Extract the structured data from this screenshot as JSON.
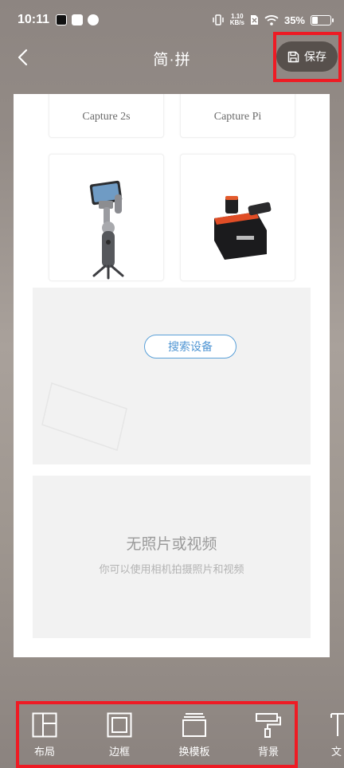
{
  "status_bar": {
    "time": "10:11",
    "net_speed_value": "1.10",
    "net_speed_unit": "KB/s",
    "battery": "35%",
    "battery_level": 0.35
  },
  "header": {
    "title": "简·拼",
    "save_label": "保存"
  },
  "canvas": {
    "products": [
      {
        "name": "Capture 2s"
      },
      {
        "name": "Capture Pi"
      }
    ],
    "search_button": "搜索设备",
    "empty_title": "无照片或视频",
    "empty_subtitle": "你可以使用相机拍摄照片和视频"
  },
  "toolbar": {
    "items": [
      {
        "label": "布局",
        "icon": "layout-icon"
      },
      {
        "label": "边框",
        "icon": "border-icon"
      },
      {
        "label": "换模板",
        "icon": "template-icon"
      },
      {
        "label": "背景",
        "icon": "background-roller-icon"
      },
      {
        "label": "文",
        "icon": "text-icon"
      }
    ]
  },
  "colors": {
    "accent_blue": "#4f95d3",
    "highlight_red": "#ee1b24",
    "save_button_bg": "#57504c"
  }
}
